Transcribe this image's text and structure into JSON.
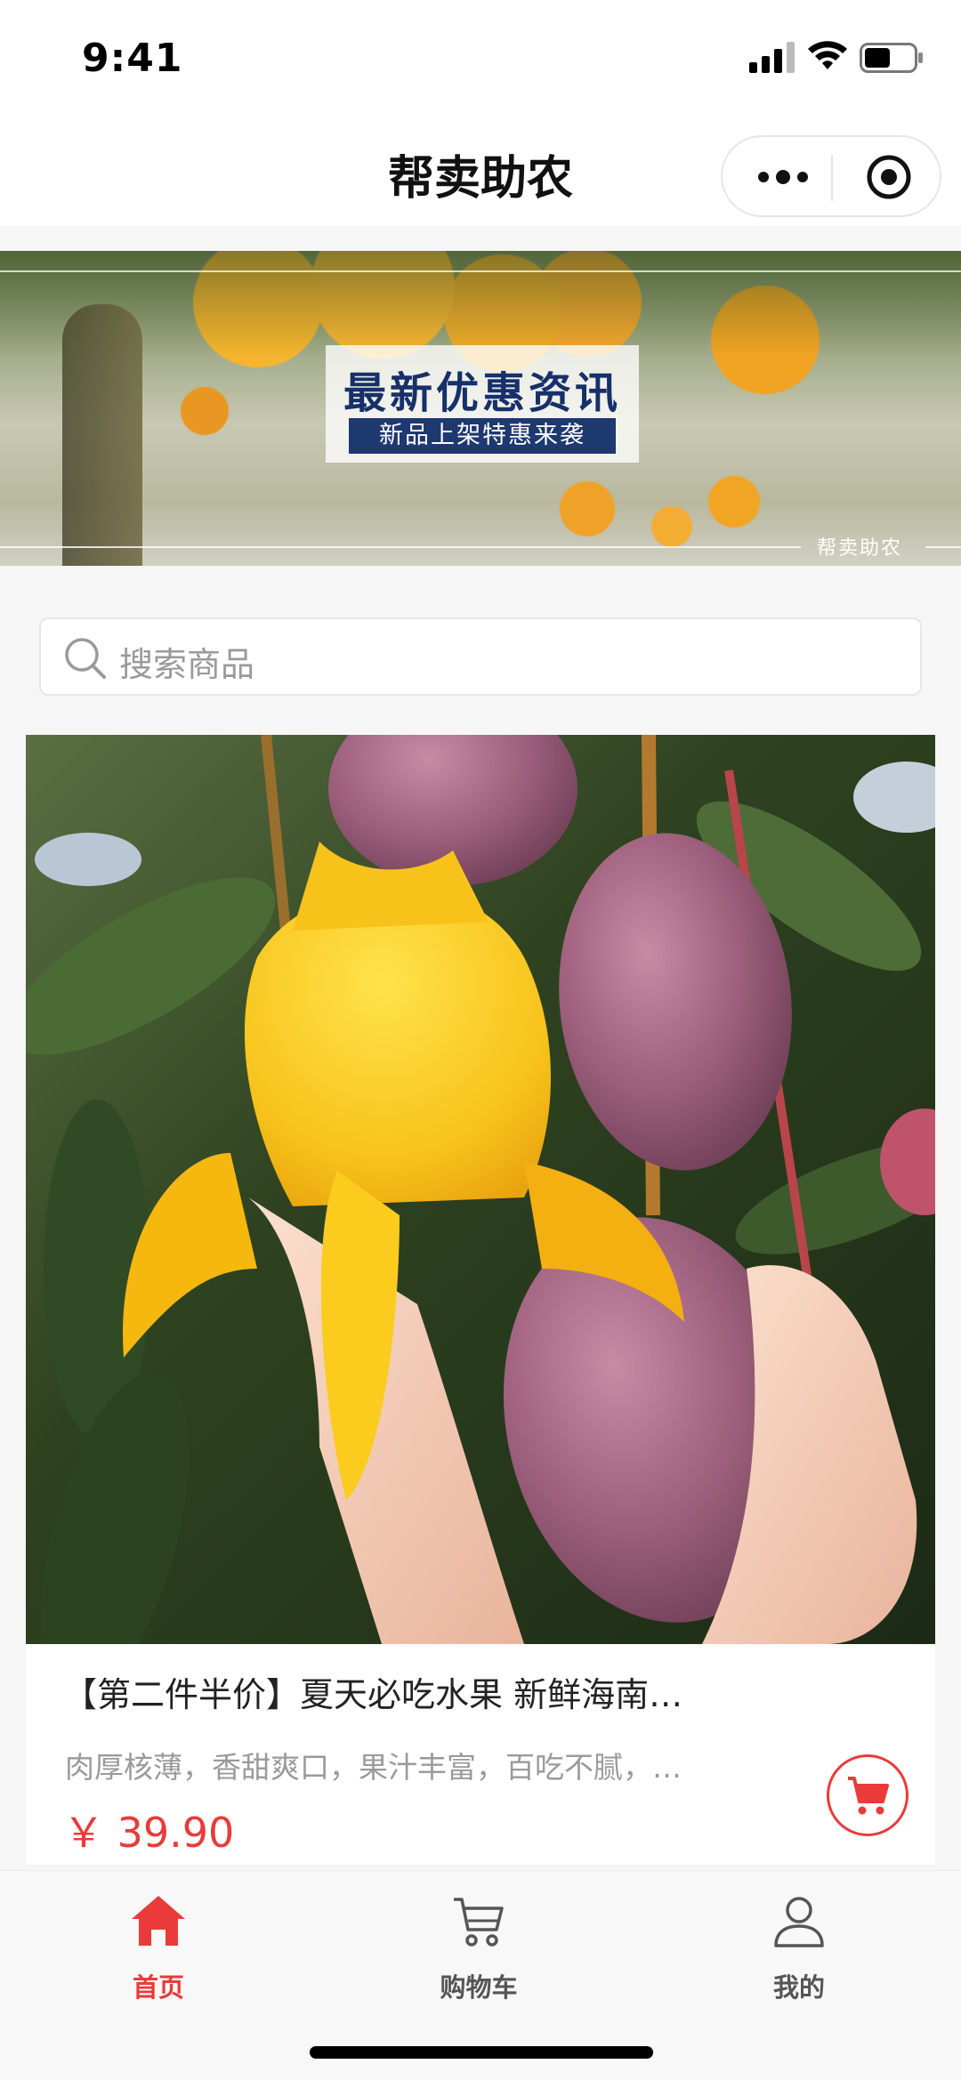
{
  "status_bar": {
    "time": "9:41"
  },
  "nav": {
    "title": "帮卖助农",
    "more_icon": "more-dots-icon",
    "close_icon": "target-icon"
  },
  "banner": {
    "headline": "最新优惠资讯",
    "subtitle": "新品上架特惠来袭",
    "watermark": "帮卖助农"
  },
  "search": {
    "placeholder": "搜索商品",
    "icon": "search-icon"
  },
  "product": {
    "title": "【第二件半价】夏天必吃水果 新鲜海南…",
    "description": "肉厚核薄，香甜爽口，果汁丰富，百吃不腻，…",
    "price": "￥ 39.90",
    "cart_icon": "cart-icon"
  },
  "tab_bar": {
    "items": [
      {
        "label": "首页",
        "icon": "home-icon",
        "active": true
      },
      {
        "label": "购物车",
        "icon": "cart-icon",
        "active": false
      },
      {
        "label": "我的",
        "icon": "user-icon",
        "active": false
      }
    ]
  },
  "colors": {
    "accent": "#ea3a3a",
    "inactive": "#555555",
    "background": "#f6f6f6"
  }
}
